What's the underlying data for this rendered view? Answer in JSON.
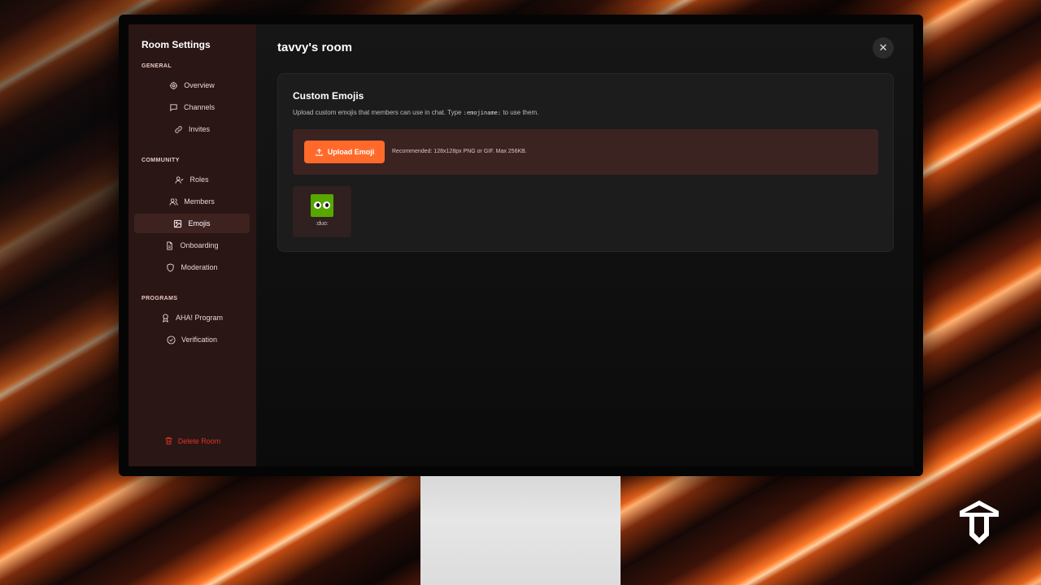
{
  "sidebar": {
    "title": "Room Settings",
    "sections": [
      {
        "label": "GENERAL"
      },
      {
        "label": "COMMUNITY"
      },
      {
        "label": "PROGRAMS"
      }
    ],
    "items": [
      {
        "label": "Overview",
        "icon": "gear-icon"
      },
      {
        "label": "Channels",
        "icon": "chat-bubble-icon"
      },
      {
        "label": "Invites",
        "icon": "link-icon"
      },
      {
        "label": "Roles",
        "icon": "user-check-icon"
      },
      {
        "label": "Members",
        "icon": "users-icon"
      },
      {
        "label": "Emojis",
        "icon": "image-icon",
        "active": true
      },
      {
        "label": "Onboarding",
        "icon": "document-icon"
      },
      {
        "label": "Moderation",
        "icon": "shield-icon"
      },
      {
        "label": "AHA! Program",
        "icon": "award-icon"
      },
      {
        "label": "Verification",
        "icon": "check-circle-icon"
      }
    ],
    "delete_label": "Delete Room"
  },
  "main": {
    "room_title": "tavvy's room",
    "close_icon": "close-icon",
    "card": {
      "title": "Custom Emojis",
      "desc_before": "Upload custom emojis that members can use in chat. Type ",
      "desc_code": ":emojiname:",
      "desc_after": " to use them.",
      "upload_label": "Upload Emoji",
      "upload_hint": "Recommended: 128x128px PNG or GIF. Max 256KB.",
      "emojis": [
        {
          "name": ":duo:"
        }
      ]
    }
  },
  "colors": {
    "accent": "#ff6a2b",
    "danger": "#d9322b",
    "sidebar_bg": "#2a1614"
  }
}
